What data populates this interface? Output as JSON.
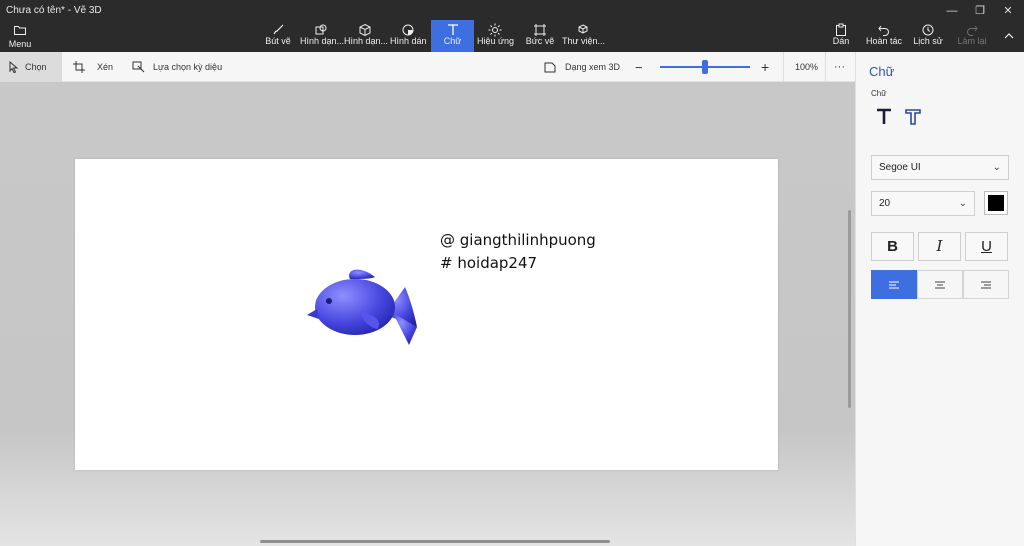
{
  "window": {
    "title": "Chưa có tên* - Vẽ 3D"
  },
  "menu": {
    "label": "Menu"
  },
  "tools": [
    {
      "label": "Bút vẽ"
    },
    {
      "label": "Hình dạn..."
    },
    {
      "label": "Hình dạn..."
    },
    {
      "label": "Hình dán"
    },
    {
      "label": "Chữ"
    },
    {
      "label": "Hiệu ứng"
    },
    {
      "label": "Bức vẽ"
    },
    {
      "label": "Thư viện..."
    }
  ],
  "actions": [
    {
      "label": "Dán"
    },
    {
      "label": "Hoàn tác"
    },
    {
      "label": "Lịch sử"
    },
    {
      "label": "Làm lại"
    }
  ],
  "subbar": {
    "select_label": "Chọn",
    "crop_label": "Xén",
    "magic_select_label": "Lựa chọn kỳ diệu",
    "view3d_label": "Dạng xem 3D",
    "zoom_out": "−",
    "zoom_in": "+",
    "zoom_level": "100%",
    "more": "···"
  },
  "canvas": {
    "line1": "@ giangthilinhpuong",
    "line2": "# hoidap247"
  },
  "panel": {
    "title": "Chữ",
    "subtitle": "Chữ",
    "font_family": "Segoe UI",
    "font_size": "20",
    "bold": "B",
    "italic": "I",
    "underline": "U",
    "text_color": "#000000",
    "accent": "#3d6fe0"
  }
}
